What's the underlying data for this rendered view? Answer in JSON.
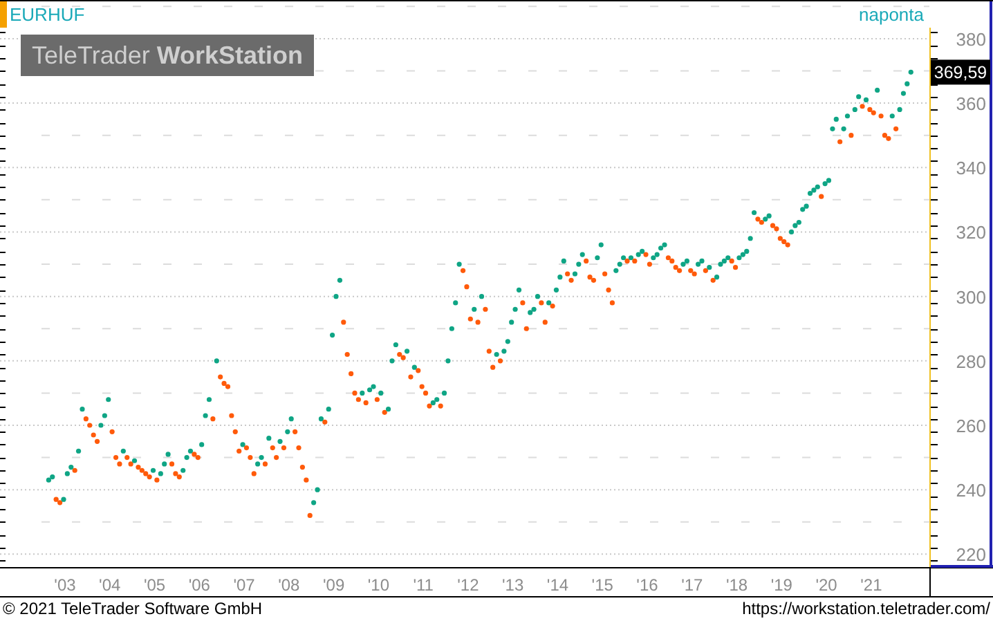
{
  "header": {
    "symbol": "EURHUF",
    "interval": "naponta"
  },
  "logo": {
    "text": "TeleTrader **WorkStation**"
  },
  "chart": {
    "last_price": "369,59",
    "chart_data": {
      "type": "scatter",
      "grid": true,
      "xlim": [
        2001.58,
        2023.75
      ],
      "ylim": [
        216,
        392
      ],
      "x": [
        2002.667,
        2002.75,
        2002.833,
        2002.917,
        2003,
        2003.083,
        2003.167,
        2003.25,
        2003.333,
        2003.417,
        2003.5,
        2003.583,
        2003.667,
        2003.75,
        2003.833,
        2003.917,
        2004,
        2004.083,
        2004.167,
        2004.25,
        2004.333,
        2004.417,
        2004.5,
        2004.583,
        2004.667,
        2004.75,
        2004.833,
        2004.917,
        2005,
        2005.083,
        2005.167,
        2005.25,
        2005.333,
        2005.417,
        2005.5,
        2005.583,
        2005.667,
        2005.75,
        2005.833,
        2005.917,
        2006,
        2006.083,
        2006.167,
        2006.25,
        2006.333,
        2006.417,
        2006.5,
        2006.583,
        2006.667,
        2006.75,
        2006.833,
        2006.917,
        2007,
        2007.083,
        2007.167,
        2007.25,
        2007.333,
        2007.417,
        2007.5,
        2007.583,
        2007.667,
        2007.75,
        2007.833,
        2007.917,
        2008,
        2008.083,
        2008.167,
        2008.25,
        2008.333,
        2008.417,
        2008.5,
        2008.583,
        2008.667,
        2008.75,
        2008.833,
        2008.917,
        2009,
        2009.083,
        2009.167,
        2009.25,
        2009.333,
        2009.417,
        2009.5,
        2009.583,
        2009.667,
        2009.75,
        2009.833,
        2009.917,
        2010,
        2010.083,
        2010.167,
        2010.25,
        2010.333,
        2010.417,
        2010.5,
        2010.583,
        2010.667,
        2010.75,
        2010.833,
        2010.917,
        2011,
        2011.083,
        2011.167,
        2011.25,
        2011.333,
        2011.417,
        2011.5,
        2011.583,
        2011.667,
        2011.75,
        2011.833,
        2011.917,
        2012,
        2012.083,
        2012.167,
        2012.25,
        2012.333,
        2012.417,
        2012.5,
        2012.583,
        2012.667,
        2012.75,
        2012.833,
        2012.917,
        2013,
        2013.083,
        2013.167,
        2013.25,
        2013.333,
        2013.417,
        2013.5,
        2013.583,
        2013.667,
        2013.75,
        2013.833,
        2013.917,
        2014,
        2014.083,
        2014.167,
        2014.25,
        2014.333,
        2014.417,
        2014.5,
        2014.583,
        2014.667,
        2014.75,
        2014.833,
        2014.917,
        2015,
        2015.083,
        2015.167,
        2015.25,
        2015.333,
        2015.417,
        2015.5,
        2015.583,
        2015.667,
        2015.75,
        2015.833,
        2015.917,
        2016,
        2016.083,
        2016.167,
        2016.25,
        2016.333,
        2016.417,
        2016.5,
        2016.583,
        2016.667,
        2016.75,
        2016.833,
        2016.917,
        2017,
        2017.083,
        2017.167,
        2017.25,
        2017.333,
        2017.417,
        2017.5,
        2017.583,
        2017.667,
        2017.75,
        2017.833,
        2017.917,
        2018,
        2018.083,
        2018.167,
        2018.25,
        2018.333,
        2018.417,
        2018.5,
        2018.583,
        2018.667,
        2018.75,
        2018.833,
        2018.917,
        2019,
        2019.083,
        2019.167,
        2019.25,
        2019.333,
        2019.417,
        2019.5,
        2019.583,
        2019.667,
        2019.75,
        2019.833,
        2019.917,
        2020,
        2020.083,
        2020.167,
        2020.25,
        2020.333,
        2020.417,
        2020.5,
        2020.583,
        2020.667,
        2020.75,
        2020.833,
        2020.917,
        2021,
        2021.083,
        2021.167,
        2021.25,
        2021.333,
        2021.417,
        2021.5,
        2021.583,
        2021.667,
        2021.75,
        2021.833,
        2021.917
      ],
      "yticks": [
        220,
        240,
        260,
        280,
        300,
        320,
        340,
        360,
        380
      ],
      "xticks": [
        {
          "value": 2003,
          "label": "'03"
        },
        {
          "value": 2004,
          "label": "'04"
        },
        {
          "value": 2005,
          "label": "'05"
        },
        {
          "value": 2006,
          "label": "'06"
        },
        {
          "value": 2007,
          "label": "'07"
        },
        {
          "value": 2008,
          "label": "'08"
        },
        {
          "value": 2009,
          "label": "'09"
        },
        {
          "value": 2010,
          "label": "'10"
        },
        {
          "value": 2011,
          "label": "'11"
        },
        {
          "value": 2012,
          "label": "'12"
        },
        {
          "value": 2013,
          "label": "'13"
        },
        {
          "value": 2014,
          "label": "'14"
        },
        {
          "value": 2015,
          "label": "'15"
        },
        {
          "value": 2016,
          "label": "'16"
        },
        {
          "value": 2017,
          "label": "'17"
        },
        {
          "value": 2018,
          "label": "'18"
        },
        {
          "value": 2019,
          "label": "'19"
        },
        {
          "value": 2020,
          "label": "'20"
        },
        {
          "value": 2021,
          "label": "'21"
        }
      ],
      "series": [
        {
          "color": "#0fa585",
          "values": [
            243,
            244,
            null,
            null,
            237,
            245,
            247,
            null,
            252,
            265,
            null,
            null,
            null,
            null,
            260,
            263,
            268,
            null,
            null,
            null,
            252,
            null,
            null,
            249,
            null,
            null,
            null,
            null,
            246,
            null,
            245,
            248,
            251,
            null,
            null,
            null,
            246,
            250,
            252,
            null,
            null,
            254,
            263,
            268,
            null,
            280,
            null,
            null,
            null,
            null,
            null,
            null,
            254,
            null,
            null,
            null,
            248,
            250,
            null,
            256,
            null,
            null,
            255,
            null,
            258,
            262,
            null,
            null,
            null,
            null,
            null,
            236,
            240,
            262,
            null,
            265,
            288,
            300,
            305,
            null,
            null,
            null,
            null,
            null,
            270,
            null,
            271,
            272,
            null,
            270,
            null,
            265,
            280,
            285,
            null,
            null,
            283,
            null,
            278,
            null,
            null,
            null,
            null,
            267,
            268,
            null,
            270,
            280,
            290,
            298,
            310,
            null,
            null,
            null,
            296,
            null,
            300,
            null,
            null,
            null,
            282,
            null,
            283,
            286,
            292,
            296,
            302,
            null,
            null,
            295,
            296,
            300,
            null,
            null,
            298,
            null,
            302,
            306,
            311,
            null,
            null,
            307,
            310,
            313,
            null,
            null,
            null,
            312,
            316,
            null,
            null,
            null,
            308,
            310,
            312,
            null,
            312,
            null,
            313,
            314,
            null,
            null,
            312,
            313,
            315,
            316,
            null,
            null,
            null,
            null,
            310,
            311,
            null,
            null,
            310,
            311,
            null,
            309,
            null,
            306,
            310,
            311,
            312,
            null,
            null,
            312,
            313,
            314,
            318,
            326,
            null,
            null,
            324,
            325,
            null,
            null,
            null,
            null,
            null,
            320,
            322,
            323,
            327,
            328,
            332,
            333,
            334,
            null,
            335,
            336,
            352,
            355,
            null,
            352,
            356,
            null,
            358,
            362,
            null,
            361,
            null,
            null,
            364,
            null,
            null,
            null,
            356,
            null,
            358,
            363,
            366,
            369.6
          ]
        },
        {
          "color": "#ff5a0a",
          "values": [
            null,
            null,
            237,
            236,
            null,
            null,
            null,
            246,
            null,
            null,
            262,
            260,
            257,
            255,
            null,
            null,
            null,
            258,
            250,
            248,
            null,
            250,
            248,
            null,
            247,
            246,
            245,
            244,
            null,
            243,
            null,
            null,
            null,
            248,
            245,
            244,
            null,
            null,
            null,
            251,
            250,
            null,
            null,
            null,
            262,
            null,
            275,
            273,
            272,
            263,
            258,
            252,
            null,
            253,
            250,
            245,
            null,
            null,
            248,
            null,
            253,
            250,
            null,
            253,
            null,
            null,
            258,
            253,
            247,
            243,
            232,
            null,
            null,
            null,
            261,
            null,
            null,
            null,
            null,
            292,
            282,
            276,
            270,
            268,
            null,
            267,
            null,
            null,
            268,
            null,
            264,
            null,
            null,
            null,
            282,
            281,
            null,
            275,
            null,
            277,
            272,
            270,
            266,
            null,
            null,
            266,
            null,
            null,
            null,
            null,
            null,
            308,
            303,
            293,
            null,
            292,
            null,
            296,
            283,
            278,
            null,
            280,
            null,
            null,
            null,
            null,
            null,
            298,
            290,
            null,
            null,
            null,
            298,
            292,
            null,
            297,
            null,
            null,
            null,
            307,
            305,
            null,
            null,
            null,
            311,
            306,
            305,
            null,
            null,
            307,
            302,
            298,
            null,
            null,
            null,
            311,
            null,
            311,
            null,
            null,
            313,
            310,
            null,
            null,
            null,
            null,
            312,
            311,
            309,
            308,
            null,
            null,
            308,
            307,
            null,
            null,
            308,
            null,
            305,
            null,
            null,
            null,
            null,
            311,
            309,
            null,
            null,
            null,
            null,
            null,
            324,
            323,
            null,
            null,
            322,
            321,
            318,
            317,
            316,
            null,
            null,
            null,
            null,
            null,
            null,
            null,
            null,
            331,
            null,
            null,
            null,
            null,
            348,
            null,
            null,
            350,
            null,
            null,
            359,
            null,
            358,
            357,
            null,
            356,
            350,
            349,
            null,
            352,
            null,
            null,
            null,
            null
          ]
        }
      ]
    }
  },
  "footer": {
    "copyright": "© 2021 TeleTrader Software GmbH",
    "url": "https://workstation.teletrader.com/"
  }
}
